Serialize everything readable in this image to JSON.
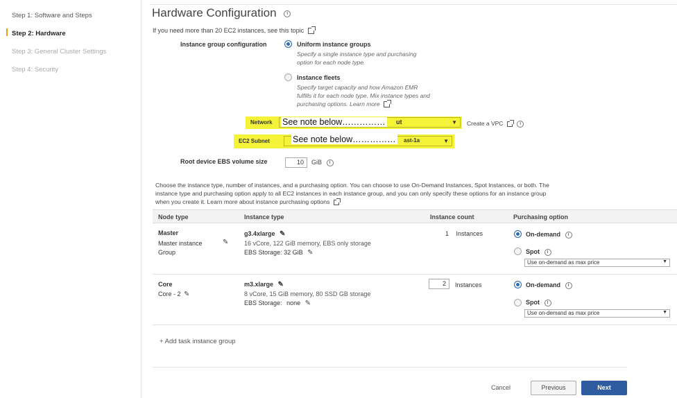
{
  "steps": [
    {
      "label": "Step 1: Software and Steps",
      "state": "done"
    },
    {
      "label": "Step 2: Hardware",
      "state": "active"
    },
    {
      "label": "Step 3: General Cluster Settings",
      "state": "disabled"
    },
    {
      "label": "Step 4: Security",
      "state": "disabled"
    }
  ],
  "header": {
    "title": "Hardware Configuration",
    "intro": "If you need more than 20 EC2 instances, see this topic"
  },
  "instance_group_config": {
    "label": "Instance group configuration",
    "uniform": {
      "label": "Uniform instance groups",
      "desc1": "Specify a single instance type and purchasing",
      "desc2": "option for each node type.",
      "selected": true
    },
    "fleets": {
      "label": "Instance fleets",
      "desc1": "Specify target capacity and how Amazon EMR",
      "desc2": "fulfills it for each node type. Mix instance types and",
      "desc3": "purchasing options.",
      "learn_more": "Learn more",
      "selected": false
    }
  },
  "network": {
    "label": "Network",
    "value_tail": "ut",
    "note": "See note below……………",
    "create_vpc": "Create a VPC"
  },
  "subnet": {
    "label": "EC2 Subnet",
    "value_tail": "ast-1a",
    "note": "See note below……………"
  },
  "root_volume": {
    "label": "Root device EBS volume size",
    "value": "10",
    "unit": "GiB"
  },
  "choose_text": {
    "line1": "Choose the instance type, number of instances, and a purchasing option. You can choose to use On-Demand Instances, Spot Instances, or both. The",
    "line2": "instance type and purchasing option apply to all EC2 instances in each instance group, and you can only specify these options for an instance group",
    "line3": "when you create it.",
    "learn_more": "Learn more about instance purchasing options"
  },
  "table": {
    "headers": {
      "node": "Node type",
      "type": "Instance type",
      "count": "Instance count",
      "purchase": "Purchasing option"
    },
    "rows": [
      {
        "node": "Master",
        "node_sub1": "Master instance",
        "node_sub2": "Group",
        "type": "g3.4xlarge",
        "spec": "16 vCore, 122 GiB memory, EBS only storage",
        "ebs": "EBS Storage:",
        "ebs_val": "32 GiB",
        "count": "1",
        "count_unit": "Instances",
        "on_demand": "On-demand",
        "spot": "Spot",
        "spot_option": "Use on-demand as max price"
      },
      {
        "node": "Core",
        "node_sub1": "Core - 2",
        "type": "m3.xlarge",
        "spec": "8 vCore, 15 GiB memory, 80 SSD GB storage",
        "ebs": "EBS Storage:",
        "ebs_val": "none",
        "count": "2",
        "count_unit": "Instances",
        "on_demand": "On-demand",
        "spot": "Spot",
        "spot_option": "Use on-demand as max price"
      }
    ],
    "add_task": "+ Add task instance group"
  },
  "footer": {
    "cancel": "Cancel",
    "previous": "Previous",
    "next": "Next"
  },
  "colors": {
    "highlight": "#f4f338",
    "primary": "#2f5ba0",
    "active_step": "#e8a317"
  }
}
